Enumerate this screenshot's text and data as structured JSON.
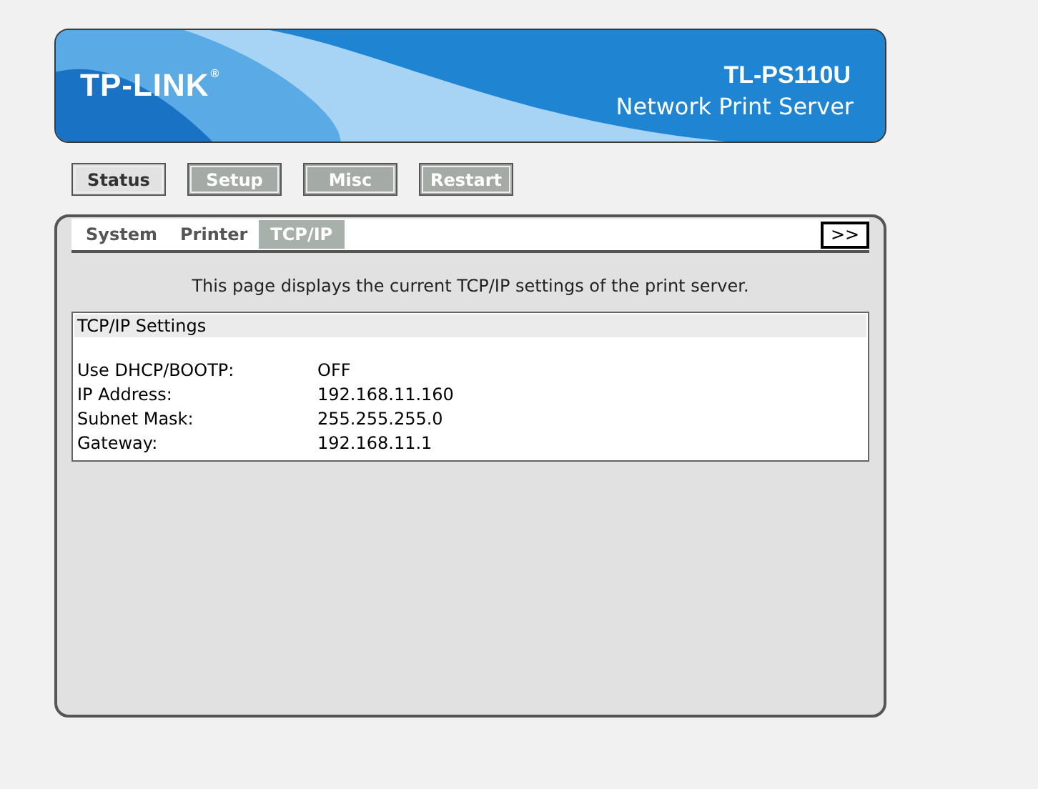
{
  "header": {
    "logo": "TP-LINK",
    "logo_mark": "®",
    "model": "TL-PS110U",
    "product": "Network Print Server"
  },
  "menu": [
    {
      "label": "Status",
      "selected": true
    },
    {
      "label": "Setup",
      "selected": false
    },
    {
      "label": "Misc",
      "selected": false
    },
    {
      "label": "Restart",
      "selected": false
    }
  ],
  "tabs": [
    {
      "label": "System",
      "selected": false
    },
    {
      "label": "Printer",
      "selected": false
    },
    {
      "label": "TCP/IP",
      "selected": true
    }
  ],
  "more_button": ">>",
  "description": "This page displays the current TCP/IP settings of the print server.",
  "settings": {
    "title": "TCP/IP Settings",
    "rows": [
      {
        "label": "Use DHCP/BOOTP:",
        "value": "OFF"
      },
      {
        "label": "IP Address:",
        "value": "192.168.11.160"
      },
      {
        "label": "Subnet Mask:",
        "value": "255.255.255.0"
      },
      {
        "label": "Gateway:",
        "value": "192.168.11.1"
      }
    ]
  }
}
